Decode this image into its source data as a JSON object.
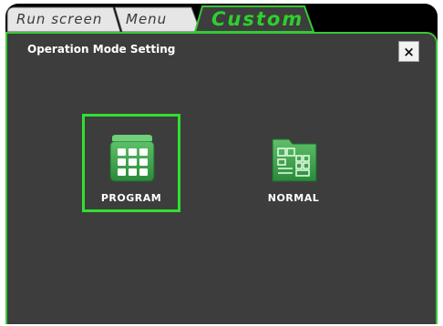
{
  "tabs": [
    {
      "label": "Run screen",
      "active": false
    },
    {
      "label": "Menu",
      "active": false
    },
    {
      "label": "Custom",
      "active": true
    }
  ],
  "panel": {
    "title": "Operation Mode Setting",
    "close_label": "×"
  },
  "modes": [
    {
      "label": "PROGRAM",
      "icon": "program-grid-icon",
      "selected": true
    },
    {
      "label": "NORMAL",
      "icon": "normal-folder-icon",
      "selected": false
    }
  ],
  "colors": {
    "accent": "#2fe02f",
    "panel_bg": "#3d3d3d",
    "icon_green": "#3aa04a"
  }
}
